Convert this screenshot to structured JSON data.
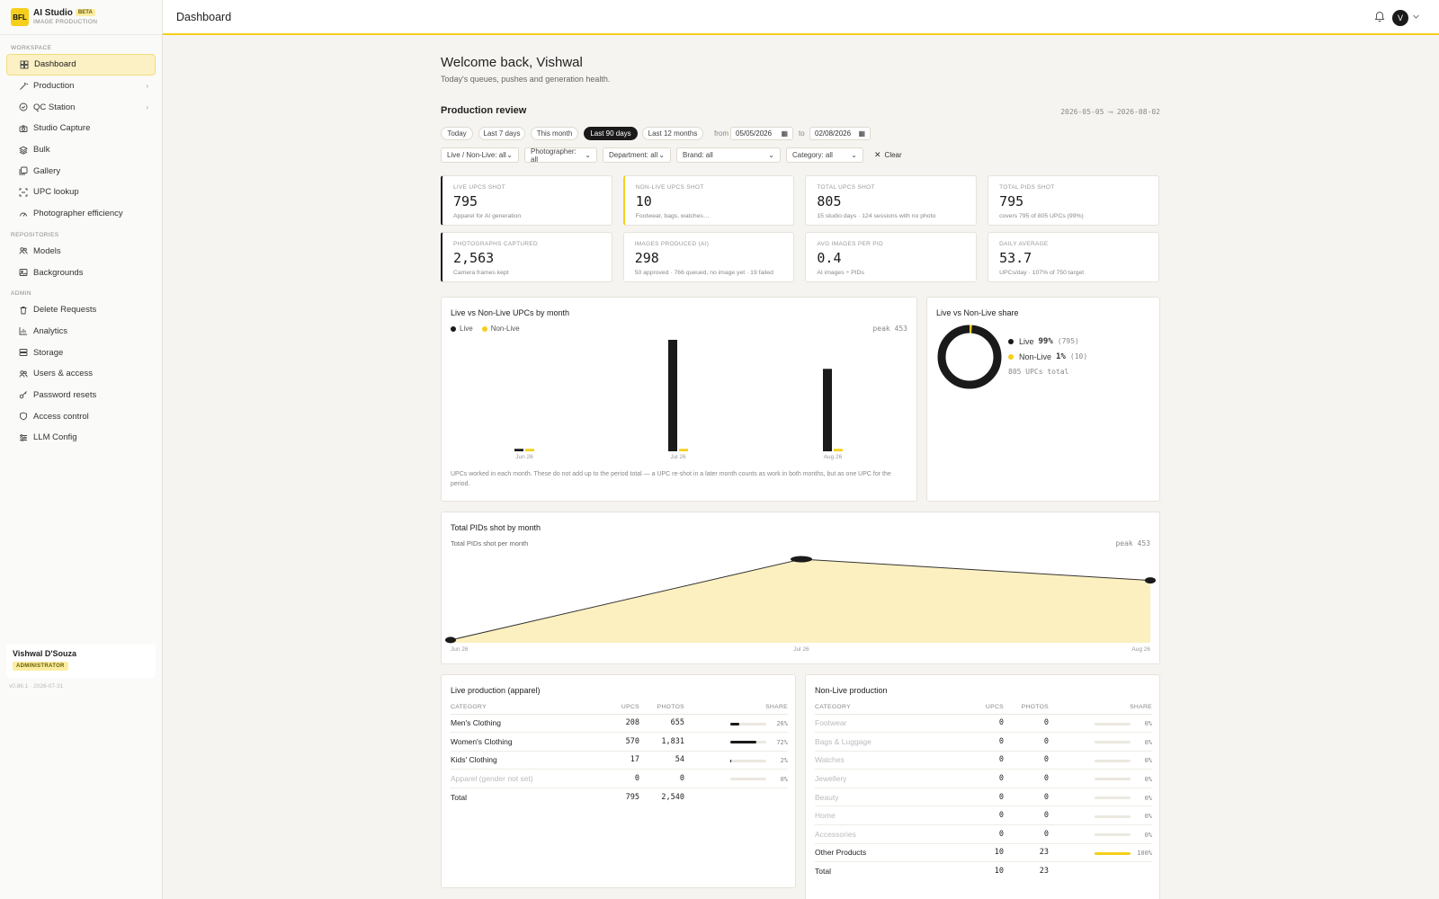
{
  "brand": {
    "logo": "BFL",
    "name": "AI Studio",
    "badge": "BETA",
    "sub": "IMAGE PRODUCTION"
  },
  "sidebar": {
    "sections": [
      {
        "title": "WORKSPACE",
        "items": [
          {
            "label": "Dashboard",
            "icon": "dashboard-icon",
            "active": true
          },
          {
            "label": "Production",
            "icon": "wand-icon",
            "chevron": true
          },
          {
            "label": "QC Station",
            "icon": "check-circle-icon",
            "chevron": true
          },
          {
            "label": "Studio Capture",
            "icon": "camera-icon"
          },
          {
            "label": "Bulk",
            "icon": "layers-icon"
          },
          {
            "label": "Gallery",
            "icon": "gallery-icon"
          },
          {
            "label": "UPC lookup",
            "icon": "scan-icon"
          },
          {
            "label": "Photographer efficiency",
            "icon": "gauge-icon"
          }
        ]
      },
      {
        "title": "REPOSITORIES",
        "items": [
          {
            "label": "Models",
            "icon": "users-icon"
          },
          {
            "label": "Backgrounds",
            "icon": "image-icon"
          }
        ]
      },
      {
        "title": "ADMIN",
        "items": [
          {
            "label": "Delete Requests",
            "icon": "trash-icon"
          },
          {
            "label": "Analytics",
            "icon": "chart-icon"
          },
          {
            "label": "Storage",
            "icon": "storage-icon"
          },
          {
            "label": "Users & access",
            "icon": "users-icon"
          },
          {
            "label": "Password resets",
            "icon": "key-icon"
          },
          {
            "label": "Access control",
            "icon": "shield-icon"
          },
          {
            "label": "LLM Config",
            "icon": "sliders-icon"
          }
        ]
      }
    ],
    "user": {
      "name": "Vishwal D'Souza",
      "role": "ADMINISTRATOR"
    },
    "version": "v0.86.1 · 2026-07-31"
  },
  "topbar": {
    "title": "Dashboard",
    "avatar": "V"
  },
  "main": {
    "welcome": "Welcome back, Vishwal",
    "welcome_sub": "Today's queues, pushes and generation health.",
    "review_title": "Production review",
    "range_label": "2026-05-05 ⟶ 2026-08-02",
    "pills": [
      "Today",
      "Last 7 days",
      "This month",
      "Last 90 days",
      "Last 12 months"
    ],
    "active_pill": "Last 90 days",
    "from_label": "from",
    "from_value": "05/05/2026",
    "to_label": "to",
    "to_value": "02/08/2026",
    "filters": [
      "Live / Non-Live: all",
      "Photographer: all",
      "Department: all",
      "Brand: all",
      "Category: all"
    ],
    "clear_label": "Clear"
  },
  "stats": [
    {
      "label": "LIVE UPCS SHOT",
      "value": "795",
      "sub": "Apparel for AI generation",
      "accent": "dark"
    },
    {
      "label": "NON-LIVE UPCS SHOT",
      "value": "10",
      "sub": "Footwear, bags, watches…",
      "accent": "yellow"
    },
    {
      "label": "TOTAL UPCS SHOT",
      "value": "805",
      "sub": "15 studio days · 124 sessions with no photo",
      "accent": "none"
    },
    {
      "label": "TOTAL PIDS SHOT",
      "value": "795",
      "sub": "covers 795 of 805 UPCs (99%)",
      "accent": "none"
    },
    {
      "label": "PHOTOGRAPHS CAPTURED",
      "value": "2,563",
      "sub": "Camera frames kept",
      "accent": "dark"
    },
    {
      "label": "IMAGES PRODUCED (AI)",
      "value": "298",
      "sub": "50 approved · 766 queued, no image yet · 19 failed",
      "accent": "none"
    },
    {
      "label": "AVG IMAGES PER PID",
      "value": "0.4",
      "sub": "AI images ÷ PIDs",
      "accent": "none"
    },
    {
      "label": "DAILY AVERAGE",
      "value": "53.7",
      "sub": "UPCs/day · 107% of 750 target",
      "accent": "none"
    }
  ],
  "colors": {
    "dark": "#1a1a1a",
    "yellow": "#f5cf1b",
    "area": "#fdf0c0"
  },
  "chart_data": [
    {
      "type": "bar",
      "title": "Live vs Non-Live UPCs by month",
      "categories": [
        "Jun 26",
        "Jul 26",
        "Aug 26"
      ],
      "series": [
        {
          "name": "Live",
          "values": [
            10,
            453,
            335
          ]
        },
        {
          "name": "Non-Live",
          "values": [
            10,
            10,
            10
          ]
        }
      ],
      "peak_label": "peak 453",
      "ylim": [
        0,
        453
      ],
      "note": "UPCs worked in each month. These do not add up to the period total — a UPC re-shot in a later month counts as work in both months, but as one UPC for the period."
    },
    {
      "type": "pie",
      "title": "Live vs Non-Live share",
      "series": [
        {
          "name": "Live",
          "pct": "99%",
          "count": "(795)",
          "value": 795
        },
        {
          "name": "Non-Live",
          "pct": "1%",
          "count": "(10)",
          "value": 10
        }
      ],
      "total_label": "805 UPCs total"
    },
    {
      "type": "area",
      "title": "Total PIDs shot by month",
      "subtitle": "Total PIDs shot per month",
      "categories": [
        "Jun 26",
        "Jul 26",
        "Aug 26"
      ],
      "values": [
        15,
        453,
        338
      ],
      "peak_label": "peak 453",
      "ylim": [
        0,
        453
      ]
    }
  ],
  "live_table": {
    "title": "Live production (apparel)",
    "headers": [
      "CATEGORY",
      "UPCS",
      "PHOTOS",
      "SHARE"
    ],
    "rows": [
      {
        "category": "Men's Clothing",
        "upcs": "208",
        "photos": "655",
        "share": 26,
        "share_label": "26%"
      },
      {
        "category": "Women's Clothing",
        "upcs": "570",
        "photos": "1,831",
        "share": 72,
        "share_label": "72%"
      },
      {
        "category": "Kids' Clothing",
        "upcs": "17",
        "photos": "54",
        "share": 2,
        "share_label": "2%"
      },
      {
        "category": "Apparel (gender not set)",
        "upcs": "0",
        "photos": "0",
        "share": 0,
        "share_label": "0%",
        "muted": true
      }
    ],
    "total": {
      "label": "Total",
      "upcs": "795",
      "photos": "2,540"
    }
  },
  "nonlive_table": {
    "title": "Non-Live production",
    "headers": [
      "CATEGORY",
      "UPCS",
      "PHOTOS",
      "SHARE"
    ],
    "rows": [
      {
        "category": "Footwear",
        "upcs": "0",
        "photos": "0",
        "share": 0,
        "share_label": "0%",
        "muted": true
      },
      {
        "category": "Bags & Luggage",
        "upcs": "0",
        "photos": "0",
        "share": 0,
        "share_label": "0%",
        "muted": true
      },
      {
        "category": "Watches",
        "upcs": "0",
        "photos": "0",
        "share": 0,
        "share_label": "0%",
        "muted": true
      },
      {
        "category": "Jewellery",
        "upcs": "0",
        "photos": "0",
        "share": 0,
        "share_label": "0%",
        "muted": true
      },
      {
        "category": "Beauty",
        "upcs": "0",
        "photos": "0",
        "share": 0,
        "share_label": "0%",
        "muted": true
      },
      {
        "category": "Home",
        "upcs": "0",
        "photos": "0",
        "share": 0,
        "share_label": "0%",
        "muted": true
      },
      {
        "category": "Accessories",
        "upcs": "0",
        "photos": "0",
        "share": 0,
        "share_label": "0%",
        "muted": true
      },
      {
        "category": "Other Products",
        "upcs": "10",
        "photos": "23",
        "share": 100,
        "share_label": "100%"
      }
    ],
    "total": {
      "label": "Total",
      "upcs": "10",
      "photos": "23"
    }
  }
}
